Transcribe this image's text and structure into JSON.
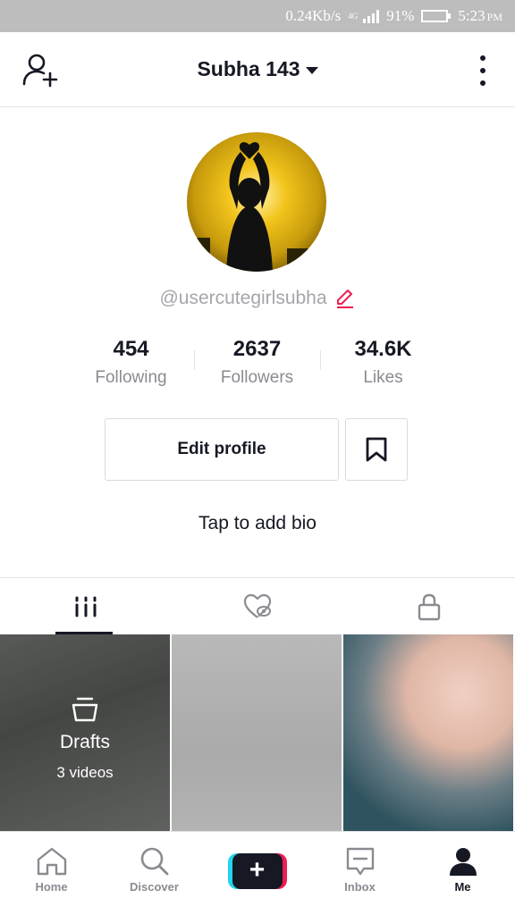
{
  "status_bar": {
    "net_speed": "0.24Kb/s",
    "network": "4G",
    "battery": "91%",
    "battery_level": 0.91,
    "time": "5:23",
    "ampm": "PM"
  },
  "header": {
    "title": "Subha 143",
    "icons": {
      "left": "add-user-icon",
      "right": "more-vertical-icon",
      "title_caret": "chevron-down-icon"
    }
  },
  "profile": {
    "username": "@usercutegirlsubha",
    "stats": [
      {
        "value": "454",
        "label": "Following"
      },
      {
        "value": "2637",
        "label": "Followers"
      },
      {
        "value": "34.6K",
        "label": "Likes"
      }
    ],
    "edit_button": "Edit profile",
    "bio_placeholder": "Tap to add bio"
  },
  "tabs": [
    {
      "icon": "grid-icon",
      "active": true
    },
    {
      "icon": "liked-private-icon",
      "active": false
    },
    {
      "icon": "lock-icon",
      "active": false
    }
  ],
  "videos": {
    "drafts_title": "Drafts",
    "drafts_count": "3 videos"
  },
  "bottom_nav": [
    {
      "label": "Home",
      "icon": "home-icon"
    },
    {
      "label": "Discover",
      "icon": "search-icon"
    },
    {
      "label": "",
      "icon": "plus-icon"
    },
    {
      "label": "Inbox",
      "icon": "inbox-icon"
    },
    {
      "label": "Me",
      "icon": "person-icon"
    }
  ],
  "colors": {
    "text_primary": "#161823",
    "text_secondary": "#8a8b91",
    "accent_red": "#ee1d52",
    "accent_cyan": "#20d5ec"
  }
}
